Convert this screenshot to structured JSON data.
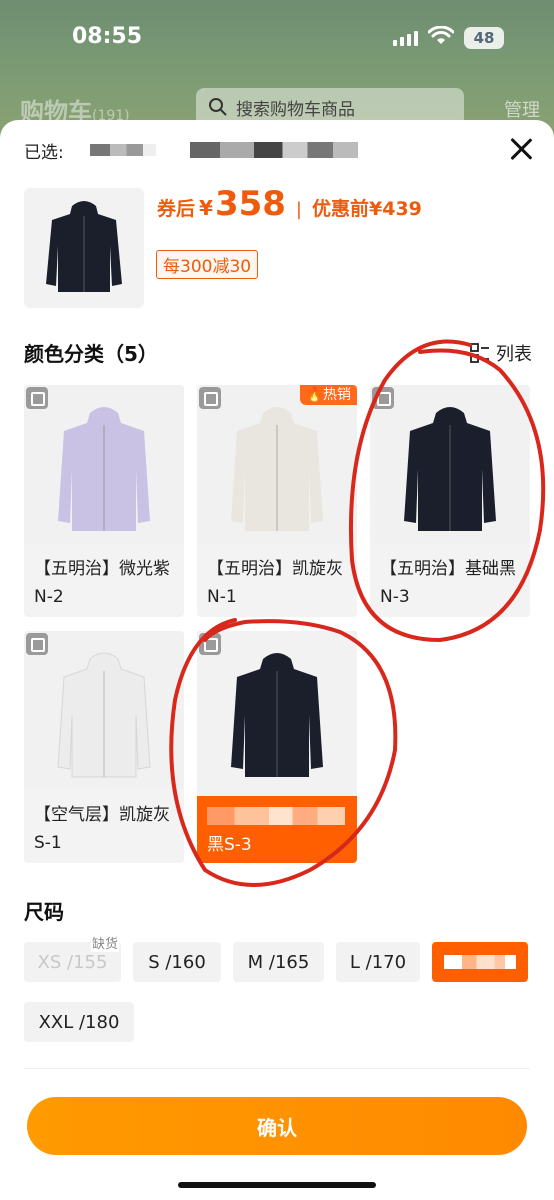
{
  "status_bar": {
    "time": "08:55",
    "battery": "48"
  },
  "background_page": {
    "title": "购物车",
    "count": "(191)",
    "search_placeholder": "搜索购物车商品",
    "manage": "管理"
  },
  "sheet": {
    "selected_label": "已选:",
    "price": {
      "after_coupon_label": "券后",
      "currency": "¥",
      "after_coupon_value": "358",
      "separator": "|",
      "before_label": "优惠前",
      "before_value": "¥439"
    },
    "promo_tag": "每300减30",
    "color_section": {
      "title": "颜色分类（5）",
      "view_toggle": "列表"
    },
    "colors": [
      {
        "label": "【五明治】微光紫N-2",
        "hot": "",
        "shirt_color": "#c9c2e4",
        "selected": false
      },
      {
        "label": "【五明治】凯旋灰N-1",
        "hot": "热销",
        "shirt_color": "#e9e6df",
        "selected": false
      },
      {
        "label": "【五明治】基础黑N-3",
        "hot": "",
        "shirt_color": "#1b1f2b",
        "selected": false
      },
      {
        "label": "【空气层】凯旋灰S-1",
        "hot": "",
        "shirt_color": "#ececec",
        "selected": false
      },
      {
        "label": "黑S-3",
        "hot": "",
        "shirt_color": "#1b1f2b",
        "selected": true
      }
    ],
    "size_section": {
      "title": "尺码"
    },
    "sizes": [
      {
        "label": "XS /155",
        "tag": "缺货",
        "disabled": true
      },
      {
        "label": "S /160",
        "tag": "",
        "disabled": false
      },
      {
        "label": "M /165",
        "tag": "",
        "disabled": false
      },
      {
        "label": "L /170",
        "tag": "",
        "disabled": false
      },
      {
        "label": "",
        "tag": "",
        "disabled": false,
        "selected": true
      },
      {
        "label": "XXL /180",
        "tag": "",
        "disabled": false
      }
    ],
    "confirm_button": "确认"
  },
  "colors": {
    "accent": "#ff5f00",
    "price": "#ef5b0c",
    "button": "#ff9000",
    "annotation": "#d8281c"
  }
}
